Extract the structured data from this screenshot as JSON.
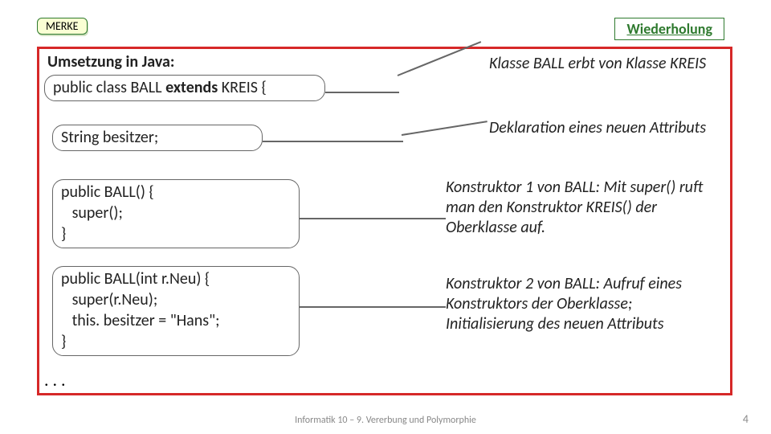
{
  "merke": "MERKE",
  "wiederholung": "Wiederholung",
  "title": "Umsetzung in Java:",
  "classdecl": {
    "pre": "public class BALL ",
    "kw": "extends",
    "post": " KREIS {"
  },
  "attr": "String besitzer;",
  "ctor1": [
    "public BALL() {",
    "   super();",
    "}"
  ],
  "ctor2": [
    "public BALL(int r.Neu) {",
    "   super(r.Neu);",
    "   this. besitzer = \"Hans\";",
    "}"
  ],
  "dots": ". . .",
  "annot1": "Klasse BALL erbt von Klasse KREIS",
  "annot2": "Deklaration eines neuen Attributs",
  "annot3": "Konstruktor 1 von BALL: Mit super() ruft man den Konstruktor KREIS() der Oberklasse auf.",
  "annot4": "Konstruktor 2 von BALL: Aufruf eines Konstruktors der Oberklasse; Initialisierung des neuen Attributs",
  "footer": "Informatik 10 – 9. Vererbung und Polymorphie",
  "pagenum": "4"
}
